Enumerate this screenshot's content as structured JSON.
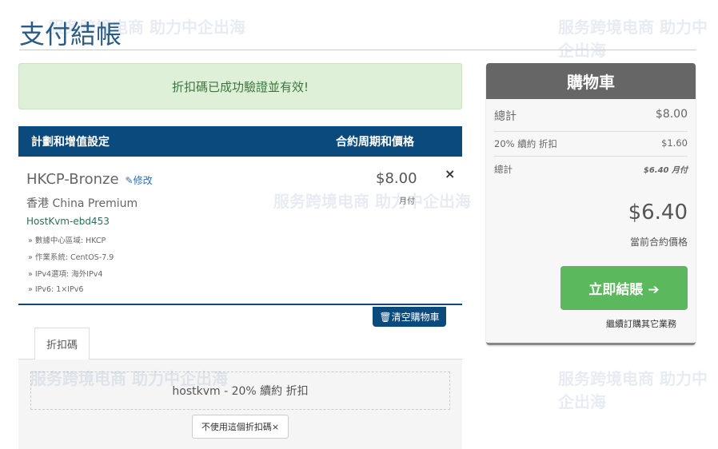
{
  "page": {
    "title": "支付結帳"
  },
  "watermark": "服务跨境电商 助力中企出海",
  "alert": "折扣碼已成功驗證並有效!",
  "table": {
    "col1": "計劃和增值設定",
    "col2": "合約周期和價格"
  },
  "item": {
    "name": "HKCP-Bronze",
    "edit": "修改",
    "group": "香港 China Premium",
    "host": "HostKvm-ebd453",
    "details": [
      "» 數據中心區域: HKCP",
      "» 作業系統: CentOS-7.9",
      "» IPv4選項: 海外IPv4",
      "» IPv6: 1×IPv6"
    ],
    "price": "$8.00",
    "cycle": "月付",
    "remove": "×"
  },
  "empty_cart": "清空購物車",
  "promo": {
    "tab": "折扣碼",
    "applied": "hostkvm - 20% 續約 折扣",
    "remove": "不使用這個折扣碼×"
  },
  "cart": {
    "title": "購物車",
    "subtotal_label": "總計",
    "subtotal": "$8.00",
    "discount_label": "20% 續約 折扣",
    "discount": "$1.60",
    "recurring_label": "總計",
    "recurring": "$6.40 月付",
    "total": "$6.40",
    "total_label": "當前合約價格",
    "checkout": "立即結賬 ➔",
    "continue": "繼續訂購其它業務"
  }
}
